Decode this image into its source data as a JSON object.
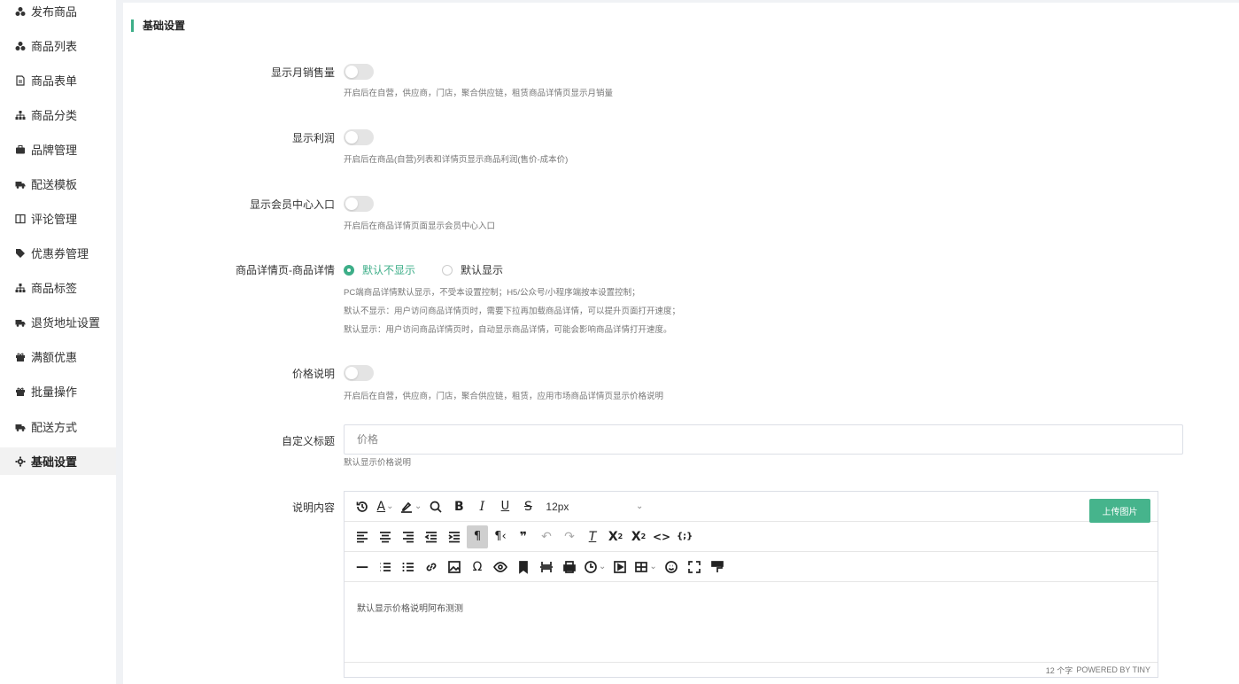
{
  "sidebar": {
    "items": [
      {
        "label": "发布商品",
        "icon": "cubes-icon"
      },
      {
        "label": "商品列表",
        "icon": "cubes-icon"
      },
      {
        "label": "商品表单",
        "icon": "file-icon"
      },
      {
        "label": "商品分类",
        "icon": "sitemap-icon"
      },
      {
        "label": "品牌管理",
        "icon": "briefcase-icon"
      },
      {
        "label": "配送模板",
        "icon": "truck-icon"
      },
      {
        "label": "评论管理",
        "icon": "columns-icon"
      },
      {
        "label": "优惠券管理",
        "icon": "tag-icon"
      },
      {
        "label": "商品标签",
        "icon": "sitemap-icon"
      },
      {
        "label": "退货地址设置",
        "icon": "truck-icon"
      },
      {
        "label": "满额优惠",
        "icon": "gift-icon"
      },
      {
        "label": "批量操作",
        "icon": "gift-icon"
      },
      {
        "label": "配送方式",
        "icon": "truck-icon"
      },
      {
        "label": "基础设置",
        "icon": "gear-icon",
        "active": true
      }
    ]
  },
  "main": {
    "section_title": "基础设置",
    "monthly_sales": {
      "label": "显示月销售量",
      "enabled": false,
      "hint": "开启后在自营，供应商，门店，聚合供应链，租赁商品详情页显示月销量"
    },
    "profit": {
      "label": "显示利润",
      "enabled": false,
      "hint": "开启后在商品(自营)列表和详情页显示商品利润(售价-成本价)"
    },
    "member_center": {
      "label": "显示会员中心入口",
      "enabled": false,
      "hint": "开启后在商品详情页面显示会员中心入口"
    },
    "detail_display": {
      "label": "商品详情页-商品详情",
      "options": [
        "默认不显示",
        "默认显示"
      ],
      "selected": "默认不显示",
      "hints": [
        "PC端商品详情默认显示，不受本设置控制；H5/公众号/小程序端按本设置控制；",
        "默认不显示：用户访问商品详情页时，需要下拉再加载商品详情，可以提升页面打开速度；",
        "默认显示：用户访问商品详情页时，自动显示商品详情，可能会影响商品详情打开速度。"
      ]
    },
    "price_note": {
      "label": "价格说明",
      "enabled": false,
      "hint": "开启后在自营，供应商，门店，聚合供应链，租赁，应用市场商品详情页显示价格说明"
    },
    "custom_title": {
      "label": "自定义标题",
      "placeholder": "价格",
      "hint": "默认显示价格说明"
    },
    "description": {
      "label": "说明内容",
      "font_size": "12px",
      "upload_label": "上传图片",
      "content": "默认显示价格说明阿布测测",
      "word_count": "12 个字",
      "powered_by": "POWERED BY TINY"
    }
  },
  "colors": {
    "accent": "#3dae88",
    "upload_button": "#46b48c"
  }
}
